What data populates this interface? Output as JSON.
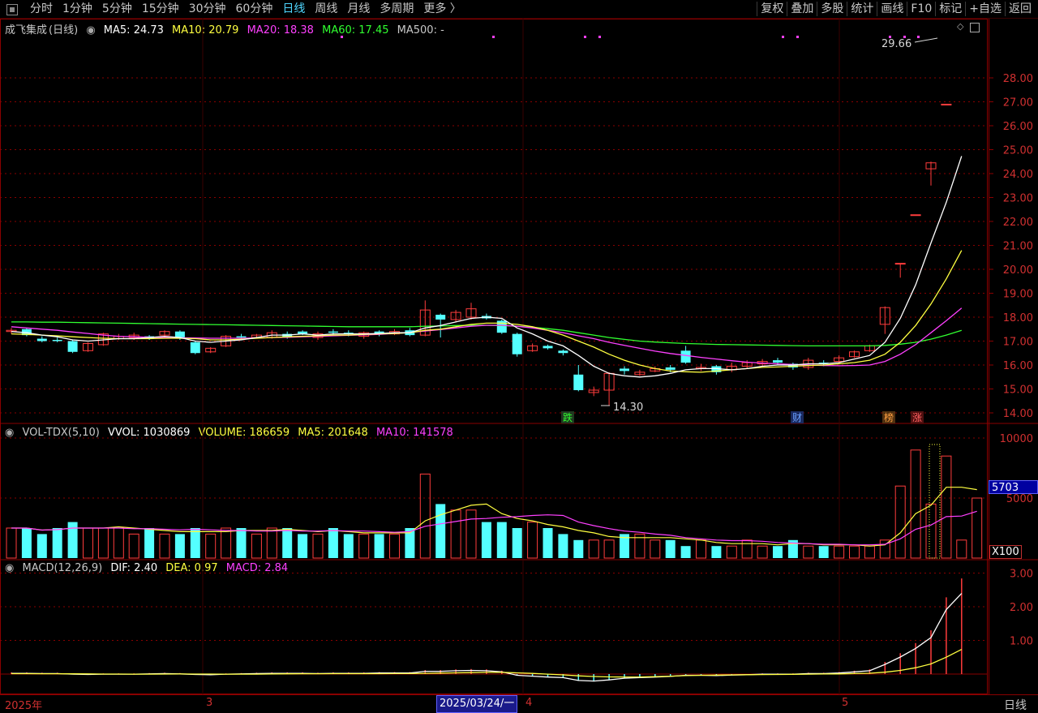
{
  "toolbar": {
    "periods": [
      "分时",
      "1分钟",
      "5分钟",
      "15分钟",
      "30分钟",
      "60分钟",
      "日线",
      "周线",
      "月线",
      "多周期",
      "更多 〉"
    ],
    "active_period": "日线",
    "right_buttons": [
      "复权",
      "叠加",
      "多股",
      "统计",
      "画线",
      "F10",
      "标记",
      "+自选",
      "返回"
    ]
  },
  "main_legend": {
    "stock": "成飞集成",
    "period_tag": "(日线)",
    "ma5": "MA5: 24.73",
    "ma10": "MA10: 20.79",
    "ma20": "MA20: 18.38",
    "ma60": "MA60: 17.45",
    "ma500": "MA500: -"
  },
  "vol_legend": {
    "name": "VOL-TDX(5,10)",
    "vvol": "VVOL: 1030869",
    "volume": "VOLUME: 186659",
    "ma5": "MA5: 201648",
    "ma10": "MA10: 141578"
  },
  "macd_legend": {
    "name": "MACD(12,26,9)",
    "dif": "DIF: 2.40",
    "dea": "DEA: 0.97",
    "macd": "MACD: 2.84"
  },
  "price_annotations": {
    "high": "29.66",
    "low": "14.30"
  },
  "event_markers": [
    "跌",
    "财",
    "榜",
    "涨"
  ],
  "volume_current": "5703",
  "volume_unit": "X100",
  "bottom": {
    "year_label": "2025年",
    "month_3": "3",
    "month_4": "4",
    "month_5": "5",
    "cursor_date": "2025/03/24/一",
    "period": "日线"
  },
  "colors": {
    "up": "#ff3c3c",
    "down": "#54ffff",
    "ma5": "#ffffff",
    "ma10": "#ffff40",
    "ma20": "#ff40ff",
    "ma60": "#30ff30",
    "grid": "#8a0000"
  },
  "chart_data": {
    "type": "candlestick",
    "title": "成飞集成 (日线)",
    "price_axis": {
      "ylim": [
        13.7,
        28.6
      ],
      "ticks": [
        14.0,
        15.0,
        16.0,
        17.0,
        18.0,
        19.0,
        20.0,
        21.0,
        22.0,
        23.0,
        24.0,
        25.0,
        26.0,
        27.0,
        28.0
      ]
    },
    "volume_axis": {
      "ticks": [
        5000,
        10000
      ],
      "unit": "X100"
    },
    "macd_axis": {
      "ticks": [
        1.0,
        2.0,
        3.0
      ]
    },
    "candles": [
      {
        "o": 17.4,
        "c": 17.45,
        "h": 17.55,
        "l": 17.3
      },
      {
        "o": 17.5,
        "c": 17.25,
        "h": 17.55,
        "l": 17.2
      },
      {
        "o": 17.1,
        "c": 17.0,
        "h": 17.2,
        "l": 16.95
      },
      {
        "o": 17.05,
        "c": 17.0,
        "h": 17.15,
        "l": 16.95
      },
      {
        "o": 17.0,
        "c": 16.55,
        "h": 17.05,
        "l": 16.5
      },
      {
        "o": 16.6,
        "c": 16.9,
        "h": 16.95,
        "l": 16.55
      },
      {
        "o": 16.85,
        "c": 17.3,
        "h": 17.35,
        "l": 16.8
      },
      {
        "o": 17.1,
        "c": 17.2,
        "h": 17.3,
        "l": 17.05
      },
      {
        "o": 17.15,
        "c": 17.25,
        "h": 17.35,
        "l": 17.05
      },
      {
        "o": 17.2,
        "c": 17.1,
        "h": 17.25,
        "l": 17.05
      },
      {
        "o": 17.25,
        "c": 17.4,
        "h": 17.45,
        "l": 17.15
      },
      {
        "o": 17.4,
        "c": 17.1,
        "h": 17.45,
        "l": 17.05
      },
      {
        "o": 16.95,
        "c": 16.5,
        "h": 17.0,
        "l": 16.45
      },
      {
        "o": 16.55,
        "c": 16.7,
        "h": 16.75,
        "l": 16.5
      },
      {
        "o": 16.8,
        "c": 17.2,
        "h": 17.25,
        "l": 16.75
      },
      {
        "o": 17.2,
        "c": 17.15,
        "h": 17.3,
        "l": 17.1
      },
      {
        "o": 17.15,
        "c": 17.25,
        "h": 17.3,
        "l": 17.1
      },
      {
        "o": 17.15,
        "c": 17.35,
        "h": 17.45,
        "l": 17.1
      },
      {
        "o": 17.3,
        "c": 17.15,
        "h": 17.4,
        "l": 17.1
      },
      {
        "o": 17.4,
        "c": 17.3,
        "h": 17.45,
        "l": 17.25
      },
      {
        "o": 17.15,
        "c": 17.3,
        "h": 17.4,
        "l": 17.05
      },
      {
        "o": 17.4,
        "c": 17.35,
        "h": 17.5,
        "l": 17.25
      },
      {
        "o": 17.35,
        "c": 17.3,
        "h": 17.45,
        "l": 17.2
      },
      {
        "o": 17.2,
        "c": 17.35,
        "h": 17.4,
        "l": 17.1
      },
      {
        "o": 17.4,
        "c": 17.3,
        "h": 17.45,
        "l": 17.2
      },
      {
        "o": 17.3,
        "c": 17.4,
        "h": 17.5,
        "l": 17.25
      },
      {
        "o": 17.45,
        "c": 17.25,
        "h": 17.55,
        "l": 17.2
      },
      {
        "o": 17.25,
        "c": 18.3,
        "h": 18.7,
        "l": 17.2
      },
      {
        "o": 18.1,
        "c": 17.9,
        "h": 18.15,
        "l": 17.15
      },
      {
        "o": 17.9,
        "c": 18.2,
        "h": 18.3,
        "l": 17.8
      },
      {
        "o": 18.0,
        "c": 18.35,
        "h": 18.6,
        "l": 17.9
      },
      {
        "o": 18.05,
        "c": 17.95,
        "h": 18.15,
        "l": 17.9
      },
      {
        "o": 17.85,
        "c": 17.35,
        "h": 17.9,
        "l": 17.3
      },
      {
        "o": 17.3,
        "c": 16.45,
        "h": 17.35,
        "l": 16.35
      },
      {
        "o": 16.6,
        "c": 16.8,
        "h": 16.9,
        "l": 16.55
      },
      {
        "o": 16.8,
        "c": 16.7,
        "h": 16.85,
        "l": 16.65
      },
      {
        "o": 16.6,
        "c": 16.5,
        "h": 16.65,
        "l": 16.4
      },
      {
        "o": 15.6,
        "c": 14.95,
        "h": 16.0,
        "l": 14.9
      },
      {
        "o": 14.85,
        "c": 14.95,
        "h": 15.1,
        "l": 14.7
      },
      {
        "o": 14.95,
        "c": 15.65,
        "h": 15.7,
        "l": 14.3
      },
      {
        "o": 15.85,
        "c": 15.75,
        "h": 15.95,
        "l": 15.6
      },
      {
        "o": 15.6,
        "c": 15.7,
        "h": 15.8,
        "l": 15.55
      },
      {
        "o": 15.75,
        "c": 15.85,
        "h": 15.95,
        "l": 15.7
      },
      {
        "o": 15.9,
        "c": 15.8,
        "h": 16.0,
        "l": 15.7
      },
      {
        "o": 16.6,
        "c": 16.1,
        "h": 16.8,
        "l": 16.05
      },
      {
        "o": 15.85,
        "c": 15.9,
        "h": 16.05,
        "l": 15.75
      },
      {
        "o": 15.95,
        "c": 15.7,
        "h": 16.0,
        "l": 15.6
      },
      {
        "o": 15.8,
        "c": 15.95,
        "h": 16.1,
        "l": 15.7
      },
      {
        "o": 15.95,
        "c": 16.1,
        "h": 16.2,
        "l": 15.85
      },
      {
        "o": 16.05,
        "c": 16.15,
        "h": 16.25,
        "l": 15.95
      },
      {
        "o": 16.2,
        "c": 16.1,
        "h": 16.3,
        "l": 16.0
      },
      {
        "o": 16.05,
        "c": 15.9,
        "h": 16.1,
        "l": 15.8
      },
      {
        "o": 15.9,
        "c": 16.2,
        "h": 16.3,
        "l": 15.8
      },
      {
        "o": 16.1,
        "c": 16.05,
        "h": 16.2,
        "l": 15.95
      },
      {
        "o": 16.15,
        "c": 16.3,
        "h": 16.4,
        "l": 16.05
      },
      {
        "o": 16.35,
        "c": 16.55,
        "h": 16.6,
        "l": 16.3
      },
      {
        "o": 16.6,
        "c": 16.8,
        "h": 16.85,
        "l": 16.55
      },
      {
        "o": 17.7,
        "c": 18.4,
        "h": 18.45,
        "l": 17.3
      },
      {
        "o": 20.25,
        "c": 20.25,
        "h": 20.25,
        "l": 19.65
      },
      {
        "o": 22.28,
        "c": 22.28,
        "h": 22.28,
        "l": 22.28
      },
      {
        "o": 24.2,
        "c": 24.45,
        "h": 24.5,
        "l": 23.5
      },
      {
        "o": 26.9,
        "c": 26.9,
        "h": 26.9,
        "l": 26.9
      }
    ],
    "ma5": [
      17.4,
      17.35,
      17.25,
      17.18,
      17.05,
      17.0,
      17.05,
      17.1,
      17.1,
      17.15,
      17.2,
      17.15,
      17.0,
      16.95,
      17.0,
      17.05,
      17.15,
      17.25,
      17.25,
      17.3,
      17.25,
      17.3,
      17.3,
      17.3,
      17.32,
      17.35,
      17.35,
      17.55,
      17.65,
      17.8,
      17.95,
      18.0,
      17.95,
      17.55,
      17.3,
      17.0,
      16.8,
      16.4,
      15.95,
      15.65,
      15.55,
      15.5,
      15.55,
      15.65,
      15.8,
      15.85,
      15.85,
      15.8,
      15.85,
      15.95,
      16.0,
      16.0,
      16.05,
      16.05,
      16.1,
      16.25,
      16.4,
      16.95,
      17.95,
      19.35,
      21.1,
      22.8,
      24.73
    ],
    "ma10": [
      17.3,
      17.28,
      17.25,
      17.22,
      17.18,
      17.15,
      17.12,
      17.1,
      17.1,
      17.1,
      17.12,
      17.12,
      17.1,
      17.05,
      17.05,
      17.08,
      17.12,
      17.15,
      17.18,
      17.2,
      17.22,
      17.25,
      17.25,
      17.28,
      17.3,
      17.32,
      17.35,
      17.45,
      17.5,
      17.6,
      17.7,
      17.75,
      17.75,
      17.7,
      17.6,
      17.45,
      17.25,
      17.0,
      16.75,
      16.45,
      16.2,
      16.0,
      15.85,
      15.75,
      15.72,
      15.7,
      15.75,
      15.8,
      15.85,
      15.9,
      15.92,
      15.95,
      15.98,
      16.0,
      16.05,
      16.1,
      16.2,
      16.45,
      16.95,
      17.65,
      18.55,
      19.6,
      20.79
    ],
    "ma20": [
      17.6,
      17.55,
      17.5,
      17.45,
      17.38,
      17.32,
      17.25,
      17.2,
      17.18,
      17.16,
      17.15,
      17.14,
      17.13,
      17.12,
      17.12,
      17.12,
      17.13,
      17.15,
      17.16,
      17.18,
      17.2,
      17.22,
      17.24,
      17.26,
      17.28,
      17.32,
      17.36,
      17.42,
      17.48,
      17.55,
      17.62,
      17.66,
      17.66,
      17.62,
      17.55,
      17.45,
      17.35,
      17.22,
      17.1,
      16.95,
      16.82,
      16.7,
      16.58,
      16.48,
      16.4,
      16.32,
      16.25,
      16.18,
      16.12,
      16.08,
      16.05,
      16.02,
      16.0,
      15.98,
      15.97,
      15.98,
      16.0,
      16.15,
      16.45,
      16.85,
      17.35,
      17.85,
      18.38
    ],
    "ma60": [
      17.8,
      17.8,
      17.79,
      17.79,
      17.78,
      17.77,
      17.76,
      17.75,
      17.74,
      17.73,
      17.72,
      17.71,
      17.7,
      17.69,
      17.68,
      17.67,
      17.66,
      17.65,
      17.64,
      17.63,
      17.62,
      17.61,
      17.6,
      17.6,
      17.6,
      17.6,
      17.6,
      17.62,
      17.63,
      17.65,
      17.66,
      17.66,
      17.65,
      17.62,
      17.58,
      17.52,
      17.45,
      17.35,
      17.25,
      17.15,
      17.07,
      17.0,
      16.96,
      16.93,
      16.9,
      16.88,
      16.86,
      16.85,
      16.84,
      16.83,
      16.82,
      16.81,
      16.8,
      16.8,
      16.8,
      16.8,
      16.8,
      16.82,
      16.87,
      16.95,
      17.08,
      17.25,
      17.45
    ],
    "volume": [
      5,
      5,
      4,
      5,
      6,
      5,
      5,
      5,
      4,
      5,
      4,
      4,
      5,
      4,
      5,
      5,
      4,
      5,
      5,
      4,
      4,
      5,
      4,
      4,
      4,
      4,
      5,
      14,
      9,
      8,
      8,
      6,
      6,
      5,
      6,
      5,
      4,
      3,
      3,
      3,
      4,
      4,
      3,
      3,
      2,
      3,
      2,
      2,
      3,
      2,
      2,
      3,
      2,
      2,
      2,
      2,
      2,
      3,
      12,
      18,
      9,
      17,
      3,
      10
    ],
    "macd_hist": [
      0.05,
      0.05,
      0.04,
      0.04,
      0.02,
      0.01,
      0.02,
      0.02,
      0.02,
      0.03,
      0.04,
      0.03,
      0.01,
      0.0,
      0.02,
      0.03,
      0.04,
      0.05,
      0.05,
      0.05,
      0.04,
      0.05,
      0.05,
      0.05,
      0.06,
      0.06,
      0.06,
      0.12,
      0.12,
      0.14,
      0.15,
      0.14,
      0.1,
      -0.02,
      -0.05,
      -0.08,
      -0.1,
      -0.2,
      -0.22,
      -0.18,
      -0.12,
      -0.1,
      -0.08,
      -0.06,
      -0.02,
      -0.02,
      -0.03,
      -0.01,
      0.0,
      0.02,
      0.02,
      0.02,
      0.04,
      0.04,
      0.06,
      0.1,
      0.14,
      0.36,
      0.62,
      0.92,
      1.3,
      2.28,
      2.84
    ]
  }
}
